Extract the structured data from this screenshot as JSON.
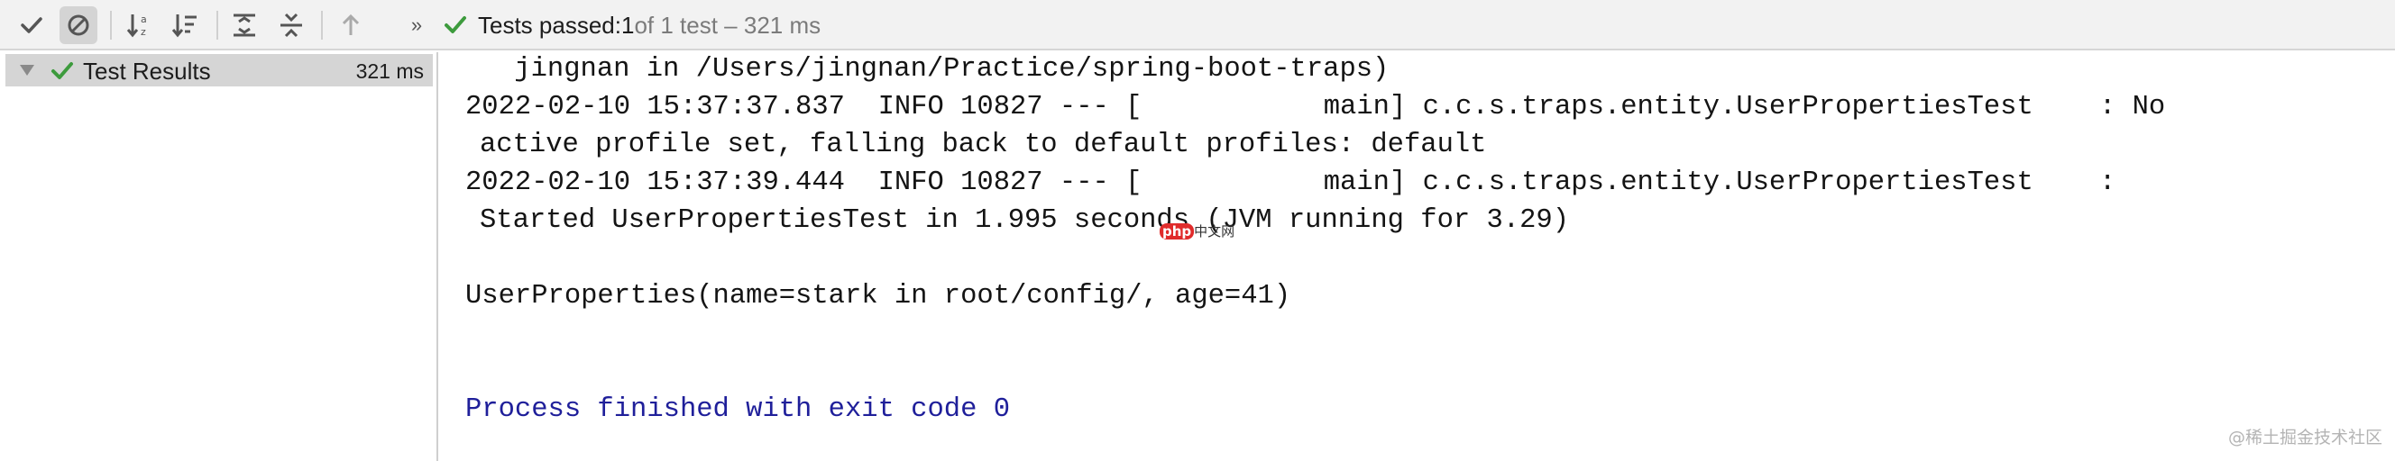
{
  "toolbar": {
    "buttons": [
      {
        "name": "show-passed",
        "icon": "check-icon"
      },
      {
        "name": "show-ignored",
        "icon": "ignored-icon",
        "active": true
      },
      {
        "name": "sort-alphabetically",
        "icon": "sort-alpha-icon"
      },
      {
        "name": "sort-by-duration",
        "icon": "sort-duration-icon"
      },
      {
        "name": "expand-all",
        "icon": "expand-all-icon"
      },
      {
        "name": "collapse-all",
        "icon": "collapse-all-icon"
      },
      {
        "name": "previous-failed",
        "icon": "arrow-up-icon"
      },
      {
        "name": "more",
        "icon": "chevron-double-right-icon"
      }
    ],
    "more_label": "»",
    "status": {
      "prefix": "Tests passed: ",
      "passed": "1",
      "suffix": " of 1 test – 321 ms"
    }
  },
  "tree": {
    "root": {
      "label": "Test Results",
      "time": "321 ms",
      "status_icon": "check-icon",
      "expand_icon": "triangle-down-icon"
    }
  },
  "console": {
    "lines": [
      " jingnan in /Users/jingnan/Practice/spring-boot-traps)",
      "2022-02-10 15:37:37.837  INFO 10827 --- [           main] c.c.s.traps.entity.UserPropertiesTest    : No",
      "active profile set, falling back to default profiles: default",
      "2022-02-10 15:37:39.444  INFO 10827 --- [           main] c.c.s.traps.entity.UserPropertiesTest    :",
      "Started UserPropertiesTest in 1.995 seconds (JVM running for 3.29)",
      "UserProperties(name=stark in root/config/, age=41)",
      "Process finished with exit code 0"
    ]
  },
  "watermarks": {
    "small_badge": "php",
    "small_text": "中文网",
    "corner": "@稀土掘金技术社区"
  },
  "colors": {
    "pass_green": "#3d9b3d",
    "console_blue": "#1f1f9a"
  }
}
